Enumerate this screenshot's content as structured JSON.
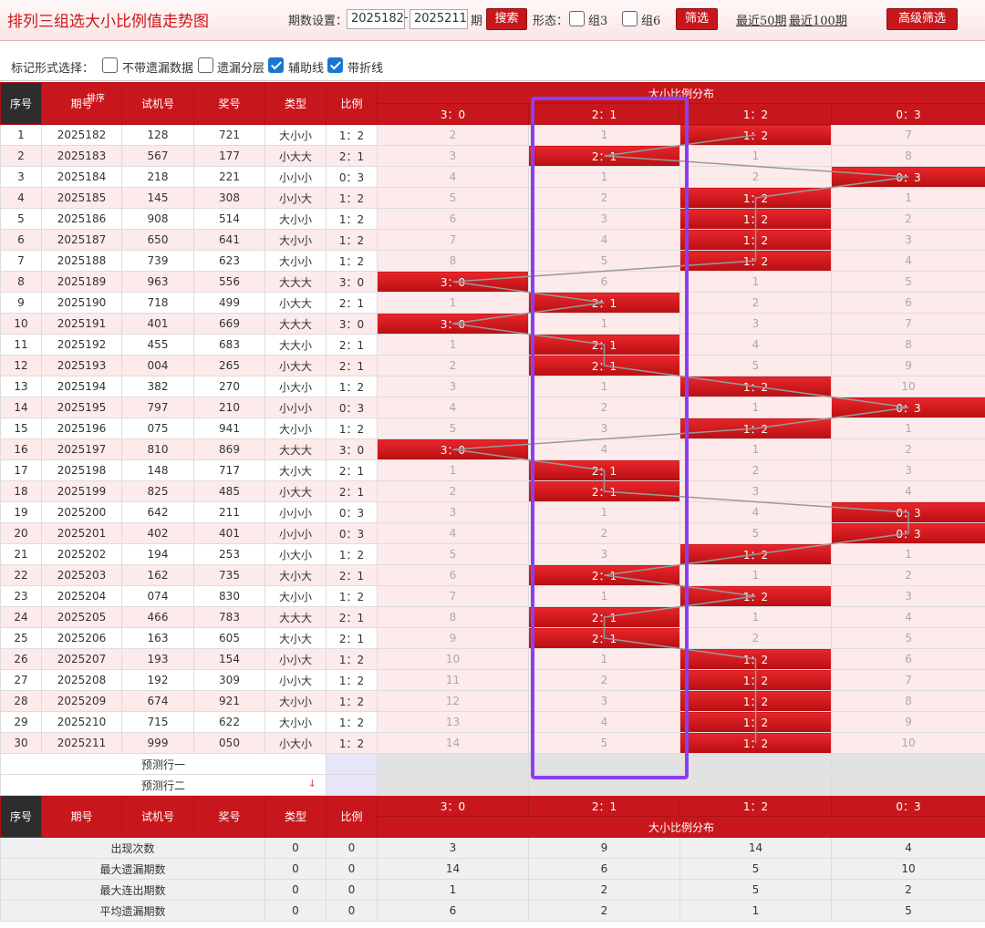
{
  "title": "排列三组选大小比例值走势图",
  "toolbar": {
    "period_label": "期数设置：",
    "from": "2025182",
    "to": "2025211",
    "period_suffix": "期",
    "search": "搜索",
    "form_label": "形态：",
    "g3": "组3",
    "g6": "组6",
    "filter": "筛选",
    "recent50": "最近50期",
    "recent100": "最近100期",
    "advanced": "高级筛选"
  },
  "markbar": {
    "label": "标记形式选择：",
    "opts": [
      {
        "label": "不带遗漏数据",
        "checked": false
      },
      {
        "label": "遗漏分层",
        "checked": false
      },
      {
        "label": "辅助线",
        "checked": true
      },
      {
        "label": "带折线",
        "checked": true
      }
    ]
  },
  "headers": {
    "seq": "序号",
    "period": "期号",
    "sort": "排序",
    "trial": "试机号",
    "prize": "奖号",
    "type": "类型",
    "ratio": "比例",
    "dist": "大小比例分布",
    "dist_cols": [
      "3：0",
      "2：1",
      "1：2",
      "0：3"
    ]
  },
  "rows": [
    {
      "seq": "1",
      "period": "2025182",
      "trial": "128",
      "prize": "721",
      "type": "大小小",
      "ratio": "1：2",
      "dist": [
        "2",
        "1",
        "1：2",
        "7"
      ]
    },
    {
      "seq": "2",
      "period": "2025183",
      "trial": "567",
      "prize": "177",
      "type": "小大大",
      "ratio": "2：1",
      "dist": [
        "3",
        "2：1",
        "1",
        "8"
      ]
    },
    {
      "seq": "3",
      "period": "2025184",
      "trial": "218",
      "prize": "221",
      "type": "小小小",
      "ratio": "0：3",
      "dist": [
        "4",
        "1",
        "2",
        "0：3"
      ]
    },
    {
      "seq": "4",
      "period": "2025185",
      "trial": "145",
      "prize": "308",
      "type": "小小大",
      "ratio": "1：2",
      "dist": [
        "5",
        "2",
        "1：2",
        "1"
      ]
    },
    {
      "seq": "5",
      "period": "2025186",
      "trial": "908",
      "prize": "514",
      "type": "大小小",
      "ratio": "1：2",
      "dist": [
        "6",
        "3",
        "1：2",
        "2"
      ]
    },
    {
      "seq": "6",
      "period": "2025187",
      "trial": "650",
      "prize": "641",
      "type": "大小小",
      "ratio": "1：2",
      "dist": [
        "7",
        "4",
        "1：2",
        "3"
      ]
    },
    {
      "seq": "7",
      "period": "2025188",
      "trial": "739",
      "prize": "623",
      "type": "大小小",
      "ratio": "1：2",
      "dist": [
        "8",
        "5",
        "1：2",
        "4"
      ]
    },
    {
      "seq": "8",
      "period": "2025189",
      "trial": "963",
      "prize": "556",
      "type": "大大大",
      "ratio": "3：0",
      "dist": [
        "3：0",
        "6",
        "1",
        "5"
      ]
    },
    {
      "seq": "9",
      "period": "2025190",
      "trial": "718",
      "prize": "499",
      "type": "小大大",
      "ratio": "2：1",
      "dist": [
        "1",
        "2：1",
        "2",
        "6"
      ]
    },
    {
      "seq": "10",
      "period": "2025191",
      "trial": "401",
      "prize": "669",
      "type": "大大大",
      "ratio": "3：0",
      "dist": [
        "3：0",
        "1",
        "3",
        "7"
      ]
    },
    {
      "seq": "11",
      "period": "2025192",
      "trial": "455",
      "prize": "683",
      "type": "大大小",
      "ratio": "2：1",
      "dist": [
        "1",
        "2：1",
        "4",
        "8"
      ]
    },
    {
      "seq": "12",
      "period": "2025193",
      "trial": "004",
      "prize": "265",
      "type": "小大大",
      "ratio": "2：1",
      "dist": [
        "2",
        "2：1",
        "5",
        "9"
      ]
    },
    {
      "seq": "13",
      "period": "2025194",
      "trial": "382",
      "prize": "270",
      "type": "小大小",
      "ratio": "1：2",
      "dist": [
        "3",
        "1",
        "1：2",
        "10"
      ]
    },
    {
      "seq": "14",
      "period": "2025195",
      "trial": "797",
      "prize": "210",
      "type": "小小小",
      "ratio": "0：3",
      "dist": [
        "4",
        "2",
        "1",
        "0：3"
      ]
    },
    {
      "seq": "15",
      "period": "2025196",
      "trial": "075",
      "prize": "941",
      "type": "大小小",
      "ratio": "1：2",
      "dist": [
        "5",
        "3",
        "1：2",
        "1"
      ]
    },
    {
      "seq": "16",
      "period": "2025197",
      "trial": "810",
      "prize": "869",
      "type": "大大大",
      "ratio": "3：0",
      "dist": [
        "3：0",
        "4",
        "1",
        "2"
      ]
    },
    {
      "seq": "17",
      "period": "2025198",
      "trial": "148",
      "prize": "717",
      "type": "大小大",
      "ratio": "2：1",
      "dist": [
        "1",
        "2：1",
        "2",
        "3"
      ]
    },
    {
      "seq": "18",
      "period": "2025199",
      "trial": "825",
      "prize": "485",
      "type": "小大大",
      "ratio": "2：1",
      "dist": [
        "2",
        "2：1",
        "3",
        "4"
      ]
    },
    {
      "seq": "19",
      "period": "2025200",
      "trial": "642",
      "prize": "211",
      "type": "小小小",
      "ratio": "0：3",
      "dist": [
        "3",
        "1",
        "4",
        "0：3"
      ]
    },
    {
      "seq": "20",
      "period": "2025201",
      "trial": "402",
      "prize": "401",
      "type": "小小小",
      "ratio": "0：3",
      "dist": [
        "4",
        "2",
        "5",
        "0：3"
      ]
    },
    {
      "seq": "21",
      "period": "2025202",
      "trial": "194",
      "prize": "253",
      "type": "小大小",
      "ratio": "1：2",
      "dist": [
        "5",
        "3",
        "1：2",
        "1"
      ]
    },
    {
      "seq": "22",
      "period": "2025203",
      "trial": "162",
      "prize": "735",
      "type": "大小大",
      "ratio": "2：1",
      "dist": [
        "6",
        "2：1",
        "1",
        "2"
      ]
    },
    {
      "seq": "23",
      "period": "2025204",
      "trial": "074",
      "prize": "830",
      "type": "大小小",
      "ratio": "1：2",
      "dist": [
        "7",
        "1",
        "1：2",
        "3"
      ]
    },
    {
      "seq": "24",
      "period": "2025205",
      "trial": "466",
      "prize": "783",
      "type": "大大大",
      "ratio": "2：1",
      "dist": [
        "8",
        "2：1",
        "1",
        "4"
      ]
    },
    {
      "seq": "25",
      "period": "2025206",
      "trial": "163",
      "prize": "605",
      "type": "大小大",
      "ratio": "2：1",
      "dist": [
        "9",
        "2：1",
        "2",
        "5"
      ]
    },
    {
      "seq": "26",
      "period": "2025207",
      "trial": "193",
      "prize": "154",
      "type": "小小大",
      "ratio": "1：2",
      "dist": [
        "10",
        "1",
        "1：2",
        "6"
      ]
    },
    {
      "seq": "27",
      "period": "2025208",
      "trial": "192",
      "prize": "309",
      "type": "小小大",
      "ratio": "1：2",
      "dist": [
        "11",
        "2",
        "1：2",
        "7"
      ]
    },
    {
      "seq": "28",
      "period": "2025209",
      "trial": "674",
      "prize": "921",
      "type": "大小小",
      "ratio": "1：2",
      "dist": [
        "12",
        "3",
        "1：2",
        "8"
      ]
    },
    {
      "seq": "29",
      "period": "2025210",
      "trial": "715",
      "prize": "622",
      "type": "大小小",
      "ratio": "1：2",
      "dist": [
        "13",
        "4",
        "1：2",
        "9"
      ]
    },
    {
      "seq": "30",
      "period": "2025211",
      "trial": "999",
      "prize": "050",
      "type": "小大小",
      "ratio": "1：2",
      "dist": [
        "14",
        "5",
        "1：2",
        "10"
      ]
    }
  ],
  "hit_col": [
    2,
    1,
    3,
    2,
    2,
    2,
    2,
    0,
    1,
    0,
    1,
    1,
    2,
    3,
    2,
    0,
    1,
    1,
    3,
    3,
    2,
    1,
    2,
    1,
    1,
    2,
    2,
    2,
    2,
    2
  ],
  "predict": [
    "预测行一",
    "预测行二"
  ],
  "stats": [
    {
      "label": "出现次数",
      "a": "0",
      "b": "0",
      "vals": [
        "3",
        "9",
        "14",
        "4"
      ]
    },
    {
      "label": "最大遗漏期数",
      "a": "0",
      "b": "0",
      "vals": [
        "14",
        "6",
        "5",
        "10"
      ]
    },
    {
      "label": "最大连出期数",
      "a": "0",
      "b": "0",
      "vals": [
        "1",
        "2",
        "5",
        "2"
      ]
    },
    {
      "label": "平均遗漏期数",
      "a": "0",
      "b": "0",
      "vals": [
        "6",
        "2",
        "1",
        "5"
      ]
    }
  ],
  "colors": {
    "accent": "#c8171c",
    "highlight": "#8a3ff0"
  }
}
